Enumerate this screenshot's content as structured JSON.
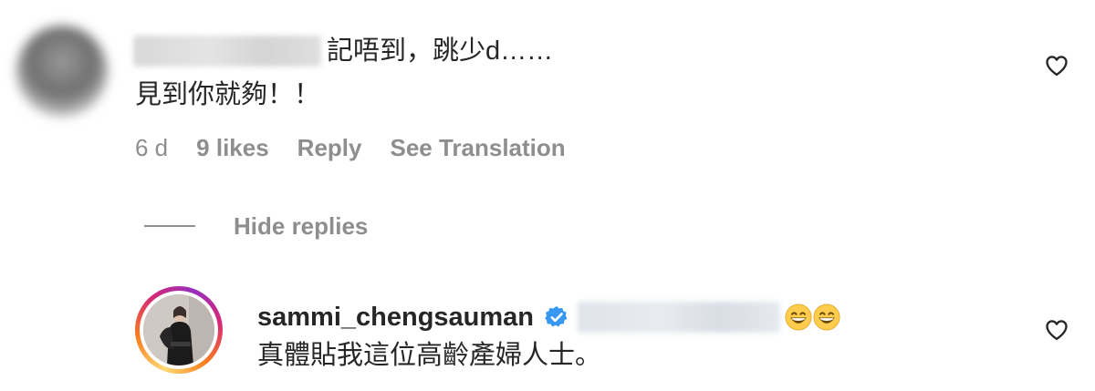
{
  "comment": {
    "username_hidden": true,
    "text_line1": "記唔到，跳少d……",
    "text_line2": "見到你就夠！！",
    "time": "6 d",
    "likes": "9 likes",
    "reply_label": "Reply",
    "translate_label": "See Translation",
    "like_icon": "heart-outline-icon"
  },
  "replies_toggle": {
    "label": "Hide replies"
  },
  "reply": {
    "username": "sammi_chengsauman",
    "verified_icon": "verified-badge-icon",
    "verified_color": "#3897f0",
    "mention_hidden": true,
    "emojis": [
      "grinning-face-icon",
      "grinning-face-icon"
    ],
    "text_line2": "真體貼我這位高齡產婦人士。",
    "like_icon": "heart-outline-icon"
  },
  "colors": {
    "primary_text": "#262626",
    "secondary_text": "#8e8e8e",
    "story_ring": [
      "#feda75",
      "#fa7e1e",
      "#d62976",
      "#962fbf"
    ]
  }
}
